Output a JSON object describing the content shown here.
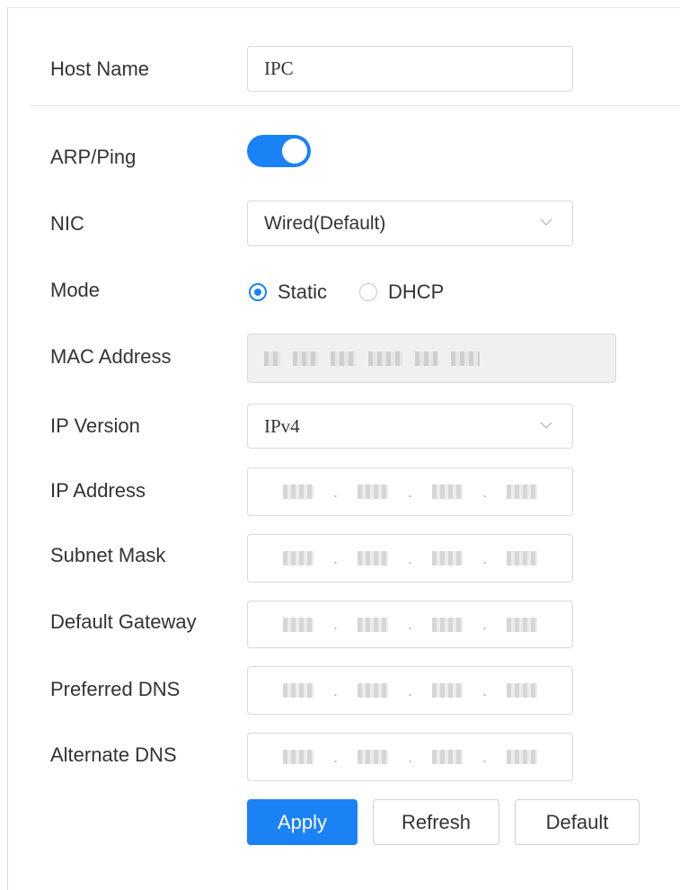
{
  "form": {
    "host_name": {
      "label": "Host Name",
      "value": "IPC"
    },
    "arp_ping": {
      "label": "ARP/Ping",
      "enabled": true
    },
    "nic": {
      "label": "NIC",
      "value": "Wired(Default)"
    },
    "mode": {
      "label": "Mode",
      "options": [
        "Static",
        "DHCP"
      ],
      "selected": "Static"
    },
    "mac_address": {
      "label": "MAC Address"
    },
    "ip_version": {
      "label": "IP Version",
      "value": "IPv4"
    },
    "ip_address": {
      "label": "IP Address"
    },
    "subnet_mask": {
      "label": "Subnet Mask"
    },
    "default_gateway": {
      "label": "Default Gateway"
    },
    "preferred_dns": {
      "label": "Preferred DNS"
    },
    "alternate_dns": {
      "label": "Alternate DNS"
    }
  },
  "buttons": {
    "apply": "Apply",
    "refresh": "Refresh",
    "default": "Default"
  },
  "colors": {
    "accent": "#1b82f6",
    "border": "#d9d9d9",
    "disabled_bg": "#f0f0f0"
  },
  "icons": {
    "dropdown": "chevron-down-icon"
  }
}
